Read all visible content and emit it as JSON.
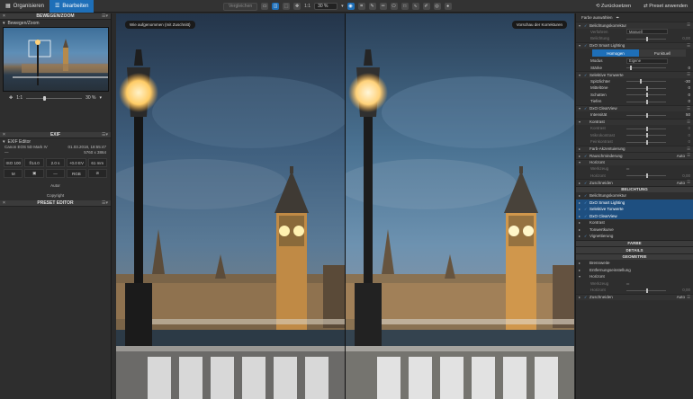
{
  "topbar": {
    "tab_organize": "Organisieren",
    "tab_edit": "Bearbeiten",
    "compare_label": "Vergleichen",
    "ratio_label": "1:1",
    "zoom_value": "30 %",
    "reset_label": "Zurücksetzen",
    "apply_preset_label": "Preset anwenden"
  },
  "left": {
    "move_zoom_title": "BEWEGEN/ZOOM",
    "move_zoom_sub": "Bewegen/Zoom",
    "zoom_ratio": "1:1",
    "zoom_percent": "30 %",
    "exif_title": "EXIF",
    "exif_sub": "EXIF Editor",
    "camera": "Canon EOS 5D Mark IV",
    "date": "01.03.2018, 18:55:47",
    "resolution": "5760 x 3864",
    "dash": "—",
    "cells": [
      "ISO 100",
      "f/14.0",
      "2.0 s",
      "+0.0 EV",
      "61 mm",
      "M",
      "▣",
      "—",
      "RGB",
      "⊘"
    ],
    "author": "Autor",
    "copyright": "Copyright",
    "preset_title": "PRESET EDITOR"
  },
  "viewer": {
    "before_label": "Wie aufgenommen (mit Zuschnitt)",
    "after_label": "Vorschau der Korrekturen"
  },
  "right": {
    "select_label": "Farbe auswählen",
    "rows": {
      "exposure": "Belichtungskorrektur",
      "exp_mode_label": "Verfahren",
      "exp_mode_value": "Manuell",
      "exp_lbl": "Belichtung",
      "exp_val": "0,00",
      "smart_lighting": "DxO Smart Lighting",
      "seg_homogen": "Homogen",
      "seg_punktuell": "Punktuell",
      "mode_label": "Modus",
      "mode_value": "Eigene",
      "strength_label": "Stärke",
      "strength_val": "0",
      "selective_tones": "Selektive Tonwerte",
      "highlights_label": "Spitzlichter",
      "highlights_val": "-30",
      "midtones_label": "Mitteltöne",
      "midtones_val": "0",
      "shadows_label": "Schatten",
      "shadows_val": "0",
      "blacks_label": "Tiefen",
      "blacks_val": "0",
      "clearview": "DxO ClearView",
      "intensity_label": "Intensität",
      "intensity_val": "50",
      "contrast": "Kontrast",
      "contrast_label": "Kontrast",
      "contrast_val": "0",
      "microcontrast_label": "Mikrokontrast",
      "microcontrast_val": "0",
      "finecontrast_label": "Feinkontrast",
      "finecontrast_val": "0",
      "color_accent": "Farb-Akzentuierung",
      "noise": "Rauschminderung",
      "noise_val": "Auto",
      "horizon": "Horizont",
      "horizon_sub": "Werkzeug",
      "horizon_lbl": "Horizont",
      "horizon_val": "0,00",
      "crop": "Zuschneiden",
      "crop_val": "Auto",
      "group_light": "BELICHTUNG",
      "l_exposure": "Belichtungskorrektur",
      "l_smart": "DxO Smart Lighting",
      "l_selective": "Selektive Tonwerte",
      "l_clearview": "DxO ClearView",
      "l_contrast": "Kontrast",
      "l_tonecurve": "Tonwertkurve",
      "l_vignette": "Vignettierung",
      "group_color": "FARBE",
      "group_detail": "DETAILS",
      "group_geometry": "GEOMETRIE",
      "g_focal": "Brennweite",
      "g_distortion": "Entfernungseinstellung",
      "g_horizon": "Horizont",
      "g_horizon_sub": "Werkzeug",
      "g_horizon_lbl": "Horizont",
      "g_horizon_val": "0,00",
      "g_crop": "Zuschneiden",
      "g_crop_val": "Auto"
    }
  },
  "colors": {
    "accent": "#1e6fb8",
    "panel": "#2e2e2e"
  }
}
